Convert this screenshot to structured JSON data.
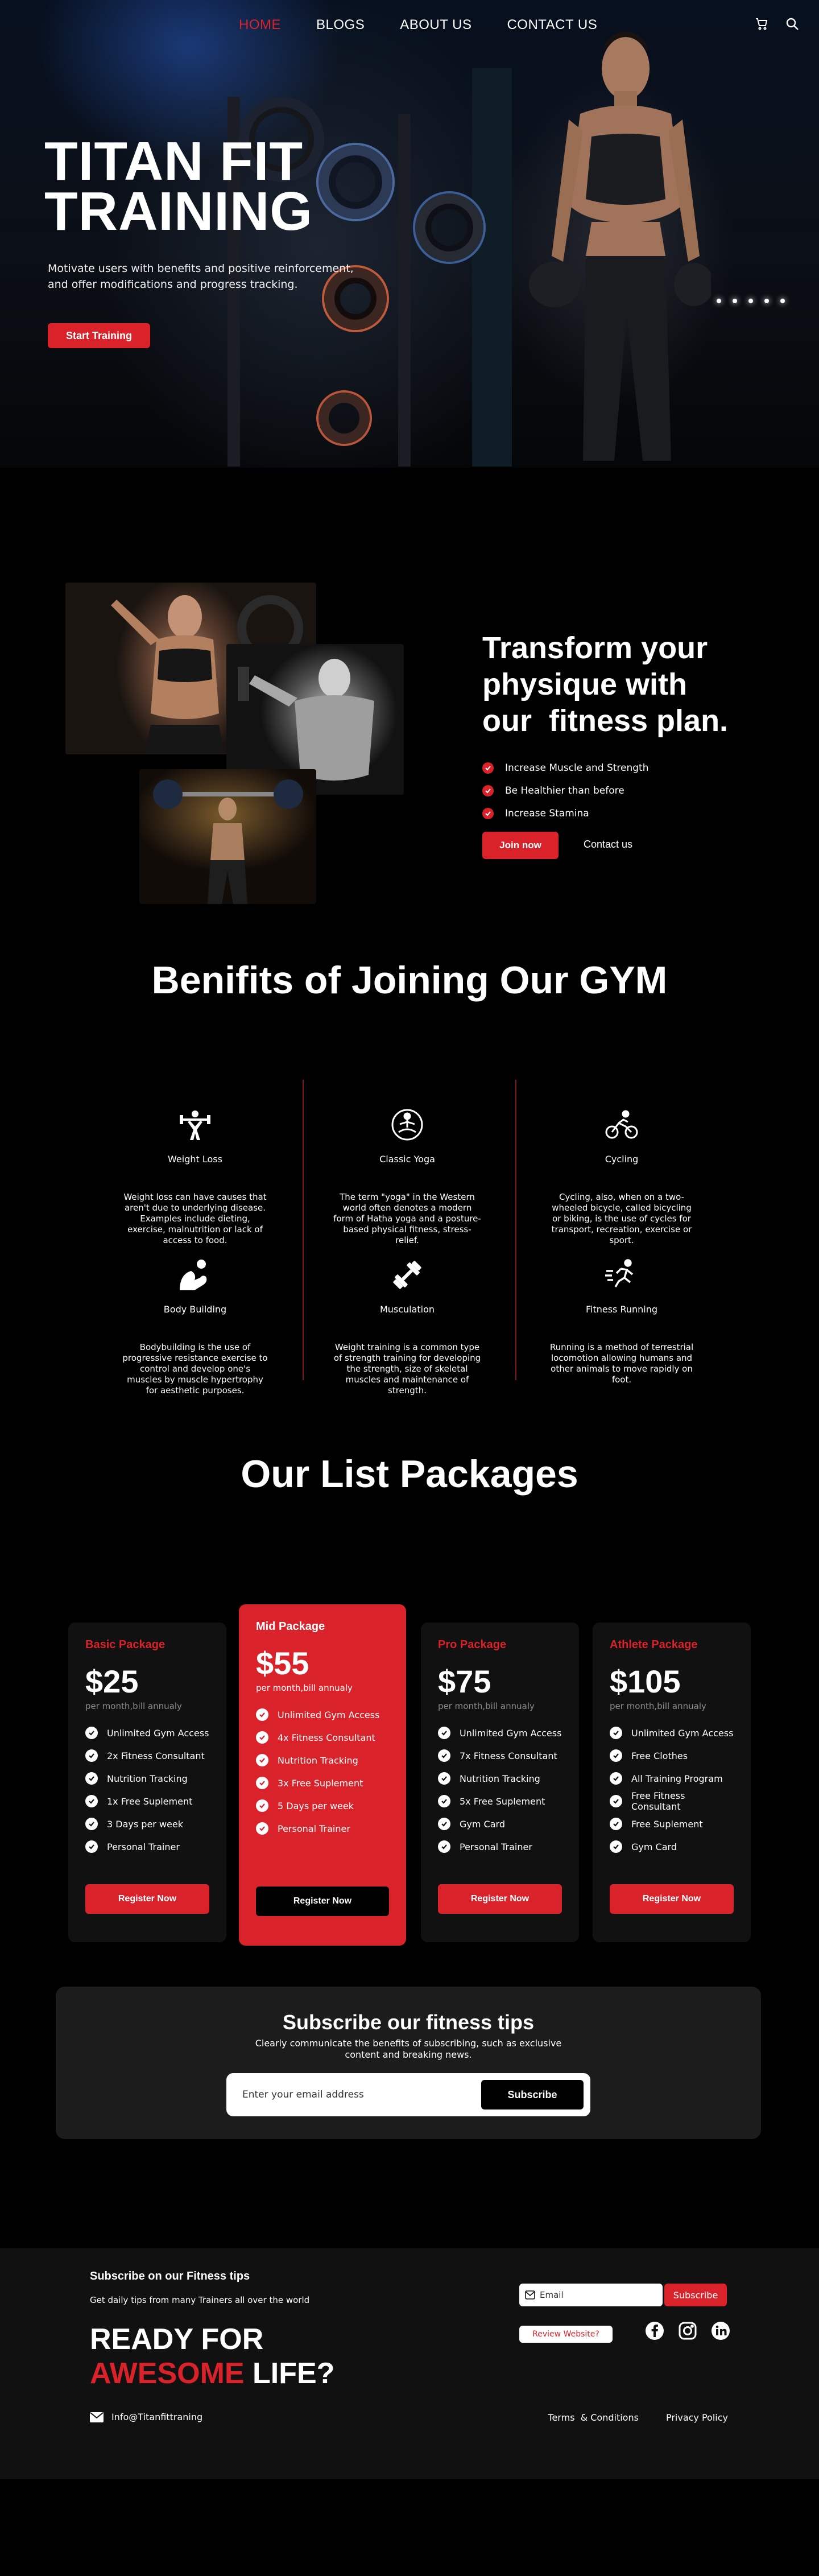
{
  "nav": {
    "links": [
      "HOME",
      "BLOGS",
      "ABOUT US",
      "CONTACT US"
    ],
    "active": "HOME",
    "icons": [
      "cart-icon",
      "search-icon"
    ]
  },
  "hero": {
    "title_line1": "TITAN FIT",
    "title_line2": "TRAINING",
    "text": "Motivate users with benefits and positive reinforcement, and offer modifications and progress tracking.",
    "button": "Start Training"
  },
  "transform": {
    "title_line1": "Transform your",
    "title_line2": "physique with",
    "title_line3": "our  fitness plan.",
    "checks": [
      "Increase Muscle and Strength",
      "Be Healthier than before",
      "Increase Stamina"
    ],
    "join": "Join now",
    "contact": "Contact us"
  },
  "benefits": {
    "title": "Benifits of Joining Our GYM",
    "items": [
      {
        "icon": "weightlifter-icon",
        "title": "Weight Loss",
        "desc": "Weight loss can have causes that aren't due to underlying disease. Examples include dieting, exercise, malnutrition or lack of access to food."
      },
      {
        "icon": "yoga-icon",
        "title": "Classic Yoga",
        "desc": "The term \"yoga\" in the Western world often denotes a modern form of Hatha yoga and a posture-based physical fitness, stress-relief."
      },
      {
        "icon": "cycling-icon",
        "title": "Cycling",
        "desc": "Cycling, also, when on a two-wheeled bicycle, called bicycling or biking, is the use of cycles for transport, recreation, exercise or sport."
      },
      {
        "icon": "bodybuilding-icon",
        "title": "Body Building",
        "desc": "Bodybuilding is the use of progressive resistance exercise to control and develop one's muscles by muscle hypertrophy for aesthetic purposes."
      },
      {
        "icon": "dumbbell-icon",
        "title": "Musculation",
        "desc": "Weight training is a common type of strength training for developing the strength, size of skeletal muscles and maintenance of strength."
      },
      {
        "icon": "running-icon",
        "title": "Fitness Running",
        "desc": "Running is a method of terrestrial locomotion allowing humans and other animals to move rapidly on foot."
      }
    ]
  },
  "packages": {
    "title": "Our List Packages",
    "per": "per month,bill annualy",
    "register": "Register Now",
    "cards": [
      {
        "name": "Basic Package",
        "price": "$25",
        "features": [
          "Unlimited Gym Access",
          "2x Fitness Consultant",
          "Nutrition Tracking",
          "1x Free Suplement",
          "3 Days per week",
          "Personal Trainer"
        ]
      },
      {
        "name": "Mid Package",
        "price": "$55",
        "features": [
          "Unlimited Gym Access",
          "4x Fitness Consultant",
          "Nutrition Tracking",
          "3x Free Suplement",
          "5 Days per week",
          "Personal Trainer"
        ]
      },
      {
        "name": "Pro Package",
        "price": "$75",
        "features": [
          "Unlimited Gym Access",
          "7x Fitness Consultant",
          "Nutrition Tracking",
          "5x Free Suplement",
          "Gym Card",
          "Personal Trainer"
        ]
      },
      {
        "name": "Athlete Package",
        "price": "$105",
        "features": [
          "Unlimited Gym Access",
          "Free Clothes",
          "All Training Program",
          "Free Fitness Consultant",
          "Free Suplement",
          "Gym Card"
        ]
      }
    ]
  },
  "subscribe": {
    "title": "Subscribe our fitness tips",
    "text": "Clearly communicate the benefits of subscribing, such as exclusive content and breaking news.",
    "placeholder": "Enter your email address",
    "button": "Subscribe"
  },
  "footer": {
    "title": "Subscribe on our Fitness tips",
    "subtitle": "Get daily tips from many Trainers all over the world",
    "big_line1": "READY FOR",
    "big_red": "AWESOME",
    "big_rest": " LIFE?",
    "email_placeholder": "Email",
    "subscribe": "Subscribe",
    "review": "Review Website?",
    "socials": [
      "facebook-icon",
      "instagram-icon",
      "linkedin-icon"
    ],
    "mail": "Info@Titanfittraning",
    "terms": "Terms  & Conditions",
    "privacy": "Privacy Policy"
  },
  "colors": {
    "accent": "#d9222a",
    "background": "#000000",
    "card": "#111111",
    "subscribe_box": "#1c1c1c"
  }
}
